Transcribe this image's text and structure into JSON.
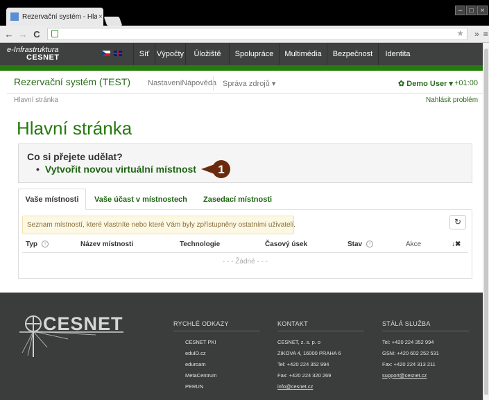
{
  "browser": {
    "tab_title": "Rezervační systém - Hlav",
    "tab_close": "×",
    "win_min": "–",
    "win_max": "□",
    "win_close": "×",
    "nav_back": "←",
    "nav_forward": "→",
    "reload": "C",
    "star": "★",
    "ext": "»",
    "menu": "≡"
  },
  "brand": {
    "line1": "e-Infrastruktura",
    "line2": "CESNET"
  },
  "topnav": [
    "Síť",
    "Výpočty",
    "Úložiště",
    "Spolupráce",
    "Multimédia",
    "Bezpečnost",
    "Identita"
  ],
  "app": {
    "title": "Rezervační systém (TEST)",
    "menu": [
      "Nastavení",
      "Nápověda",
      "Správa zdrojů ▾"
    ],
    "user": "✿ Demo User ▾",
    "timezone": "+01:00",
    "breadcrumb": "Hlavní stránka",
    "report": "Nahlásit problém"
  },
  "main": {
    "heading": "Hlavní stránka",
    "question": "Co si přejete udělat?",
    "action_bullet": "•",
    "action": "Vytvořit novou virtuální místnost",
    "badge": "1",
    "tabs": [
      "Vaše místnosti",
      "Vaše účast v místnostech",
      "Zasedací místnosti"
    ],
    "alert": "Seznam místností, které vlastníte nebo které Vám byly zpřístupněny ostatními uživateli.",
    "refresh_icon": "↻",
    "columns": [
      "Typ",
      "Název místnosti",
      "Technologie",
      "Časový úsek",
      "Stav",
      "Akce"
    ],
    "info_glyph": "i",
    "sort_icon": "↓✖",
    "empty": "- - - Žádné - - -"
  },
  "footer": {
    "logo": "CESNET",
    "quick_links": {
      "heading": "RYCHLÉ ODKAZY",
      "items": [
        "CESNET PKI",
        "eduID.cz",
        "eduroam",
        "MetaCentrum",
        "PERUN"
      ]
    },
    "contact": {
      "heading": "KONTAKT",
      "items": [
        "CESNET, z. s. p. o",
        "ZIKOVA 4, 16000 PRAHA 6",
        "Tel: +420 224 352 994",
        "Fax: +420 224 320 269",
        "info@cesnet.cz"
      ]
    },
    "service": {
      "heading": "STÁLÁ SLUŽBA",
      "items": [
        "Tel: +420 224 352 994",
        "GSM: +420 602 252 531",
        "Fax: +420 224 313 211",
        "support@cesnet.cz"
      ]
    }
  },
  "colors": {
    "green": "#257a0c",
    "dark": "#3f4040",
    "badge": "#6b2a0e"
  }
}
